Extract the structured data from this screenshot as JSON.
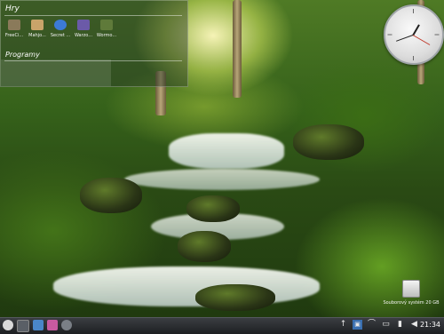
{
  "folderview": {
    "title": "Hry",
    "items": [
      {
        "label": "FreeCi...",
        "icon": "freeciv-icon",
        "color": "#8a7a5a"
      },
      {
        "label": "Mahjo...",
        "icon": "mahjongg-icon",
        "color": "#c9a46a"
      },
      {
        "label": "Secret ...",
        "icon": "secret-maryo-icon",
        "color": "#3c7ad6"
      },
      {
        "label": "Warzo...",
        "icon": "warzone-icon",
        "color": "#6b5aa8"
      },
      {
        "label": "Wormo...",
        "icon": "wormux-icon",
        "color": "#5f7a3a"
      }
    ],
    "section_title": "Programy"
  },
  "device": {
    "label": "Souborový systém 20 GB"
  },
  "panel": {
    "launchers": [
      {
        "icon": "kickoff-menu-icon",
        "color": "#d9d9d9"
      },
      {
        "icon": "window-switcher-icon",
        "color": "#5a5f66"
      },
      {
        "icon": "browser-icon",
        "color": "#4a86c8"
      },
      {
        "icon": "media-player-icon",
        "color": "#c85aa0"
      },
      {
        "icon": "app-launcher-icon",
        "color": "#7a7f86"
      }
    ],
    "tray": [
      {
        "icon": "arrow-up-icon",
        "glyph": "↑"
      },
      {
        "icon": "network-icon",
        "glyph": "▣"
      },
      {
        "icon": "wifi-icon",
        "glyph": "⌒"
      },
      {
        "icon": "folder-icon",
        "glyph": "▭"
      },
      {
        "icon": "battery-icon",
        "glyph": "▮"
      },
      {
        "icon": "volume-icon",
        "glyph": "◀"
      }
    ],
    "clock": "21:34"
  }
}
